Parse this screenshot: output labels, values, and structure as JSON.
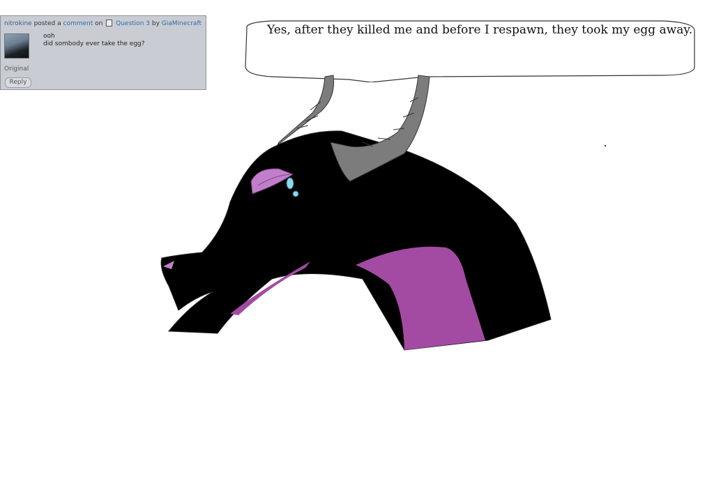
{
  "comment": {
    "user": "nitrokine",
    "posted_a": "posted a",
    "comment_word": "comment",
    "on": "on",
    "target": "Question 3",
    "by": "by",
    "author": "GiaMinecraft",
    "lines": [
      "ooh",
      "did sombody ever take the egg?"
    ],
    "original_label": "Original",
    "reply_label": "Reply"
  },
  "speech": {
    "text": "Yes, after they killed me and before I respawn, they took my egg away."
  },
  "colors": {
    "dragon_body": "#000000",
    "dragon_purple": "#a34aa3",
    "horn_gray": "#7c7c7c",
    "eye_pink": "#c17fc9",
    "tear_blue": "#8fd7ef"
  },
  "icons": {
    "document": "document-icon"
  }
}
